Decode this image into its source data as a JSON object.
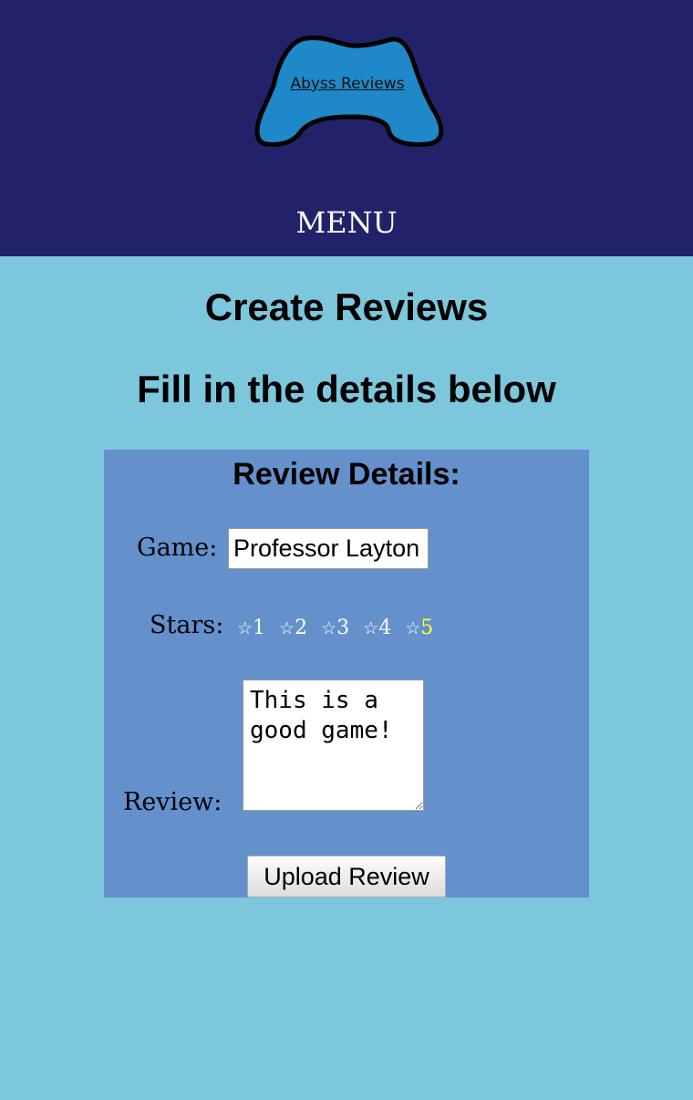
{
  "header": {
    "logo_text": "Abyss Reviews",
    "menu_label": "MENU",
    "logo_color": "#1f88c8",
    "background": "#22226a"
  },
  "main": {
    "title": "Create Reviews",
    "subtitle": "Fill in the details below"
  },
  "form": {
    "title": "Review Details:",
    "game_label": "Game:",
    "game_value": "Professor Layton",
    "stars_label": "Stars:",
    "star_glyph": "☆",
    "stars": [
      {
        "label": "1",
        "selected": false
      },
      {
        "label": "2",
        "selected": false
      },
      {
        "label": "3",
        "selected": false
      },
      {
        "label": "4",
        "selected": false
      },
      {
        "label": "5",
        "selected": true
      }
    ],
    "selected_rating": 5,
    "review_label": "Review:",
    "review_value": "This is a good game!",
    "upload_label": "Upload Review",
    "panel_color": "#6490cc"
  }
}
